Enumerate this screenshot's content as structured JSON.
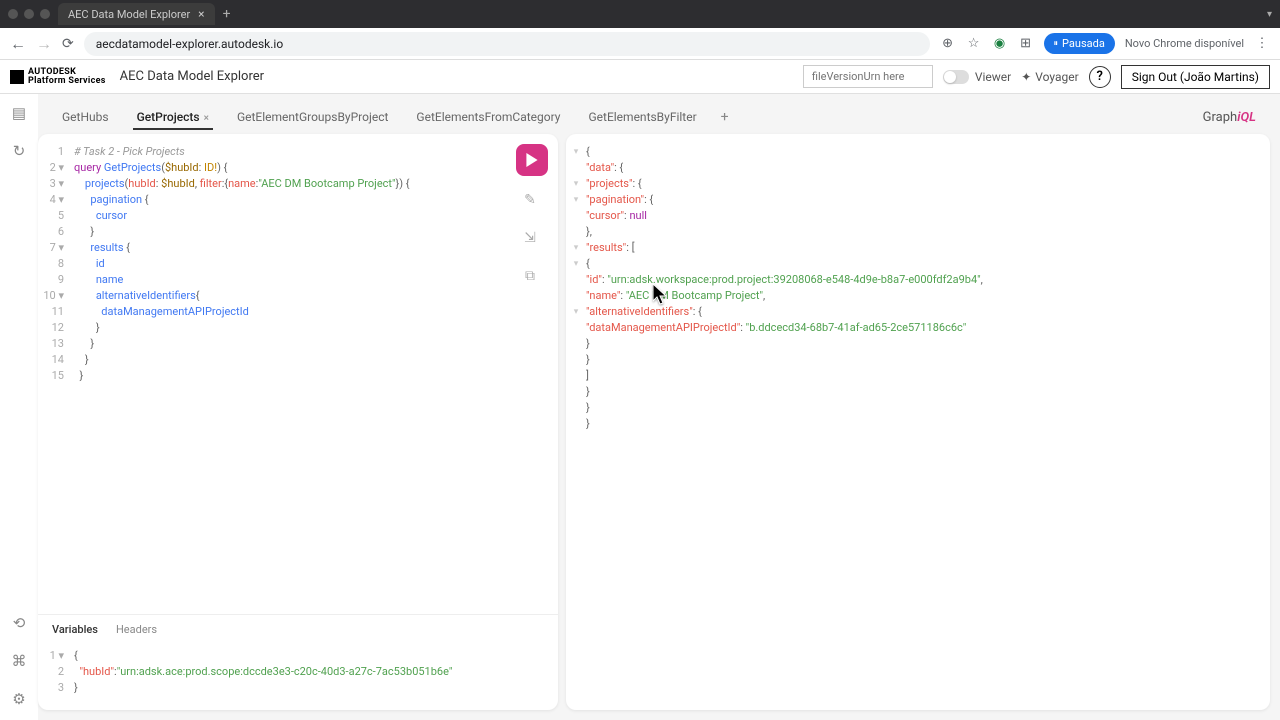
{
  "browser": {
    "tab_title": "AEC Data Model Explorer",
    "url": "aecdatamodel-explorer.autodesk.io",
    "pausada": "Pausada",
    "chrome_avail": "Novo Chrome disponível"
  },
  "header": {
    "logo_line1": "AUTODESK",
    "logo_line2": "Platform Services",
    "app_title": "AEC Data Model Explorer",
    "file_placeholder": "fileVersionUrn here",
    "viewer_label": "Viewer",
    "voyager_label": "Voyager",
    "signout": "Sign Out (João Martins)"
  },
  "tabs": [
    {
      "label": "GetHubs",
      "active": false
    },
    {
      "label": "GetProjects",
      "active": true
    },
    {
      "label": "GetElementGroupsByProject",
      "active": false
    },
    {
      "label": "GetElementsFromCategory",
      "active": false
    },
    {
      "label": "GetElementsByFilter",
      "active": false
    }
  ],
  "brand_prefix": "Graph",
  "brand_suffix": "iQL",
  "query": {
    "l1": "# Task 2 - Pick Projects",
    "l2_kw": "query",
    "l2_name": "GetProjects",
    "l2_var": "$hubId",
    "l2_type": "ID!",
    "l3_field": "projects",
    "l3_arg1": "hubId",
    "l3_var": "$hubId",
    "l3_arg2": "filter",
    "l3_fkey": "name",
    "l3_str": "\"AEC DM Bootcamp Project\"",
    "l4": "pagination",
    "l5": "cursor",
    "l7": "results",
    "l8": "id",
    "l9": "name",
    "l10": "alternativeIdentifiers",
    "l11": "dataManagementAPIProjectId"
  },
  "vars_tabs": {
    "variables": "Variables",
    "headers": "Headers"
  },
  "variables": {
    "key": "\"hubId\"",
    "val": "\"urn:adsk.ace:prod.scope:dccde3e3-c20c-40d3-a27c-7ac53b051b6e\""
  },
  "response": {
    "data_k": "\"data\"",
    "projects_k": "\"projects\"",
    "pagination_k": "\"pagination\"",
    "cursor_k": "\"cursor\"",
    "cursor_v": "null",
    "results_k": "\"results\"",
    "id_k": "\"id\"",
    "id_v": "\"urn:adsk.workspace:prod.project:39208068-e548-4d9e-b8a7-e000fdf2a9b4\"",
    "name_k": "\"name\"",
    "name_v": "\"AEC DM Bootcamp Project\"",
    "alt_k": "\"alternativeIdentifiers\"",
    "dm_k": "\"dataManagementAPIProjectId\"",
    "dm_v": "\"b.ddcecd34-68b7-41af-ad65-2ce571186c6c\""
  }
}
